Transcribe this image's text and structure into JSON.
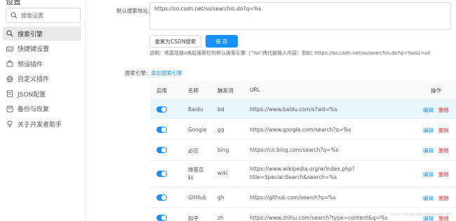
{
  "sidebar": {
    "title": "设置",
    "search_placeholder": "搜索设置",
    "items": [
      {
        "label": "搜索引擎",
        "icon": "search-icon"
      },
      {
        "label": "快捷键设置",
        "icon": "keyboard-icon"
      },
      {
        "label": "预设插件",
        "icon": "plugin-icon"
      },
      {
        "label": "自定义插件",
        "icon": "globe-icon"
      },
      {
        "label": "JSON配置",
        "icon": "document-icon"
      },
      {
        "label": "备份与恢复",
        "icon": "backup-icon"
      },
      {
        "label": "关于开发者助手",
        "icon": "lightbulb-icon"
      }
    ]
  },
  "settings": {
    "default_label": "默认搜索地址:",
    "default_url": "https://so.csdn.net/so/search/s.do?q=%s",
    "reset_button": "重置为CSDN搜索",
    "save_button": "保 存",
    "hint": "说明：将更改按o唤起搜索栏的默认搜索引擎（\"%s\"将代替输入内容）例如: https://so.csdn.net/so/search/s.do?q=%s&t=all",
    "engine_label": "搜索引擎:",
    "add_engine": "添加搜索引擎"
  },
  "table": {
    "headers": {
      "enabled": "启用",
      "name": "名称",
      "trigger": "触发词",
      "url": "URL",
      "actions": "操作"
    },
    "edit_label": "编辑",
    "delete_label": "删除",
    "rows": [
      {
        "name": "Baidu",
        "trigger": "bd",
        "url": "https://www.baidu.com/s?wd=%s",
        "url2": ""
      },
      {
        "name": "Google",
        "trigger": "gg",
        "url": "https://www.google.com/search?q=%s",
        "url2": ""
      },
      {
        "name": "必应",
        "trigger": "bing",
        "url": "https://cn.bing.com/search?q=%s",
        "url2": ""
      },
      {
        "name": "维基百\n科",
        "trigger": "wiki",
        "url": "https://www.wikipedia.org/w/index.php?",
        "url2": "title=Special:Search&search=%s"
      },
      {
        "name": "GitHub",
        "trigger": "gh",
        "url": "https://github.com/search?q=%s",
        "url2": ""
      },
      {
        "name": "知乎",
        "trigger": "zh",
        "url": "https://www.zhihu.com/search?type=content&q=%s",
        "url2": ""
      }
    ]
  },
  "watermark": "https://blog.csdn.net/weixin_44...",
  "colors": {
    "accent": "#1890ff",
    "danger": "#f5222d",
    "active_nav": "#e9e9e9",
    "highlight_row": "#eaf6fd"
  }
}
